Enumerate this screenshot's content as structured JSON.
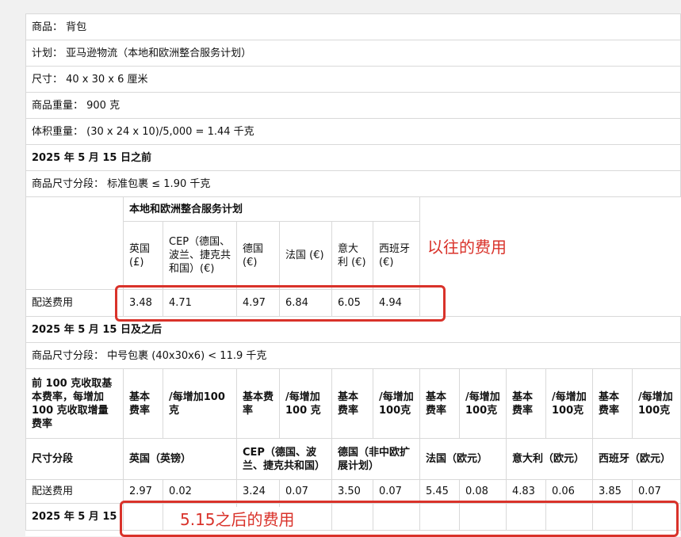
{
  "info_rows": {
    "product": "商品：  背包",
    "plan": "计划：  亚马逊物流（本地和欧洲整合服务计划）",
    "size": "尺寸：  40 x 30 x 6 厘米",
    "weight": "商品重量：  900 克",
    "volume": "体积重量：  (30 x 24 x 10)/5,000 = 1.44 千克"
  },
  "before": {
    "title": "2025 年 5 月 15 日之前",
    "tier": "商品尺寸分段：  标准包裹 ≤ 1.90 千克",
    "plan_header": "本地和欧洲整合服务计划",
    "columns": [
      "英国 (£)",
      "CEP（德国、波兰、捷克共和国）(€)",
      "德国 (€)",
      "法国 (€)",
      "意大利 (€)",
      "西班牙 (€)"
    ],
    "row_label": "配送费用",
    "values": [
      "3.48",
      "4.71",
      "4.97",
      "6.84",
      "6.05",
      "4.94"
    ]
  },
  "after": {
    "title": "2025 年 5 月 15 日及之后",
    "tier": "商品尺寸分段：  中号包裹 (40x30x6) < 11.9 千克",
    "rate_desc": "前 100 克收取基本费率，每增加 100 克收取增量费率",
    "base_label": "基本费率",
    "incr_labels": [
      "/每增加100克",
      "/每增加 100 克",
      "/每增加100克",
      "/每增加100克",
      "/每增加100克",
      "/每增加100克"
    ],
    "tier_label": "尺寸分段",
    "countries": [
      "英国（英镑）",
      "CEP（德国、波兰、捷克共和国）",
      "德国（非中欧扩展计划）",
      "法国（欧元）",
      "意大利（欧元）",
      "西班牙（欧元）"
    ],
    "row_label": "配送费用",
    "values": [
      "2.97",
      "0.02",
      "3.24",
      "0.07",
      "3.50",
      "0.07",
      "5.45",
      "0.08",
      "4.83",
      "0.06",
      "3.85",
      "0.07"
    ]
  },
  "cutoff_row": "2025 年 5 月 15",
  "annotations": {
    "before_label": "以往的费用",
    "after_label": "5.15之后的费用",
    "color": "#d9322a"
  }
}
